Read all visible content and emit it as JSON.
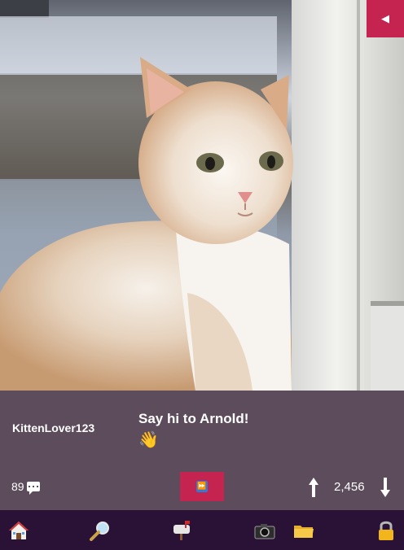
{
  "post": {
    "username": "KittenLover123",
    "caption": "Say hi to Arnold!",
    "caption_emoji": "👋",
    "comment_count": "89",
    "score": "2,456"
  },
  "controls": {
    "back_glyph": "◀",
    "fast_forward_glyph": "⏩"
  },
  "nav": {
    "items": [
      {
        "name": "home-icon"
      },
      {
        "name": "search-icon"
      },
      {
        "name": "mailbox-icon"
      },
      {
        "name": "camera-icon"
      },
      {
        "name": "folder-icon"
      },
      {
        "name": "lock-icon"
      }
    ]
  },
  "colors": {
    "accent": "#c4244f",
    "panel": "#5d4d5c",
    "navbar": "#2a1236"
  }
}
